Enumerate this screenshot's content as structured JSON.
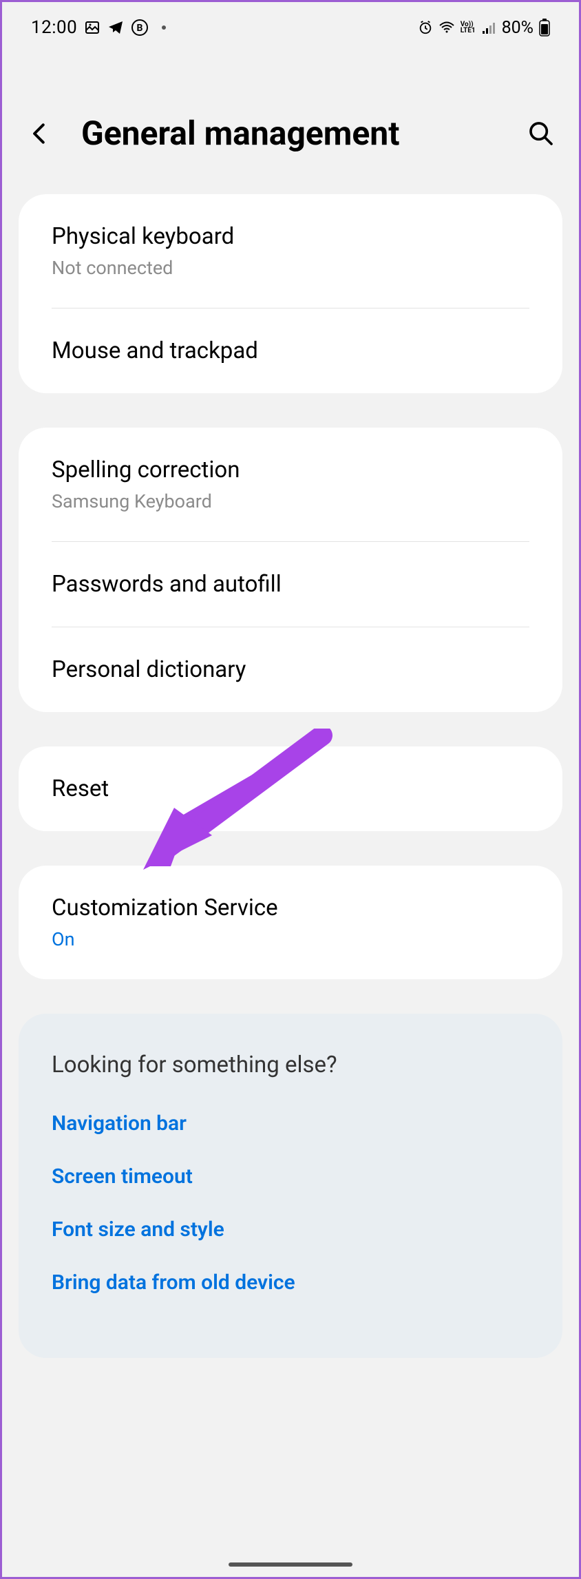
{
  "status_bar": {
    "time": "12:00",
    "battery": "80%"
  },
  "header": {
    "title": "General management"
  },
  "group1": {
    "physical_keyboard": {
      "title": "Physical keyboard",
      "subtitle": "Not connected"
    },
    "mouse_trackpad": {
      "title": "Mouse and trackpad"
    }
  },
  "group2": {
    "spelling": {
      "title": "Spelling correction",
      "subtitle": "Samsung Keyboard"
    },
    "passwords": {
      "title": "Passwords and autofill"
    },
    "dictionary": {
      "title": "Personal dictionary"
    }
  },
  "group3": {
    "reset": {
      "title": "Reset"
    }
  },
  "group4": {
    "customization": {
      "title": "Customization Service",
      "status": "On"
    }
  },
  "suggestions": {
    "title": "Looking for something else?",
    "links": {
      "nav": "Navigation bar",
      "timeout": "Screen timeout",
      "font": "Font size and style",
      "bring": "Bring data from old device"
    }
  }
}
